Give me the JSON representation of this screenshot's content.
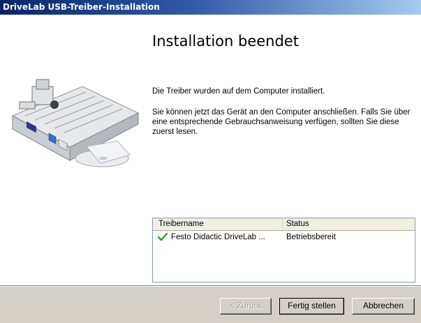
{
  "window": {
    "title": "DriveLab USB-Treiber-Installation"
  },
  "main": {
    "heading": "Installation beendet",
    "message_installed": "Die Treiber wurden auf dem Computer installiert.",
    "message_connect": "Sie können jetzt das Gerät an den Computer anschließen. Falls Sie über eine entsprechende Gebrauchsanweisung verfügen, sollten Sie diese zuerst lesen."
  },
  "driver_list": {
    "columns": [
      "Treibername",
      "Status"
    ],
    "rows": [
      {
        "name": "Festo Didactic DriveLab ...",
        "status": "Betriebsbereit",
        "icon": "green-check-icon"
      }
    ]
  },
  "buttons": {
    "back": "< Zurück",
    "finish": "Fertig stellen",
    "cancel": "Abbrechen"
  },
  "colors": {
    "titlebar_start": "#0a246a",
    "titlebar_end": "#a6caf0",
    "dialog_face": "#d4d0c8",
    "check_green": "#2e9b2e"
  }
}
